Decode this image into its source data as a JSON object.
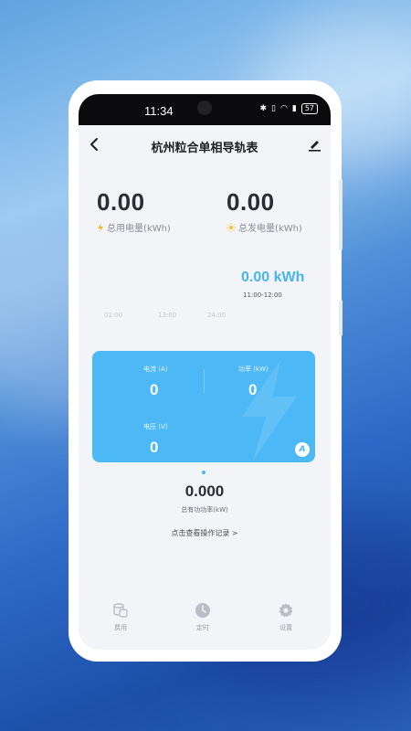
{
  "status_bar": {
    "time": "11:34",
    "battery": "57"
  },
  "header": {
    "title": "杭州粒合单相导轨表"
  },
  "stats": {
    "total_used_value": "0.00",
    "total_used_label": "总用电量(kWh)",
    "total_generated_value": "0.00",
    "total_generated_label": "总发电量(kWh)"
  },
  "chart": {
    "current_value": "0.00 kWh",
    "time_range": "11:00-12:00",
    "ticks": [
      "01:00",
      "13:00",
      "24:00"
    ]
  },
  "card": {
    "current_label": "电流 (A)",
    "current_value": "0",
    "power_label": "功率 (kW)",
    "power_value": "0",
    "voltage_label": "电压 (V)",
    "voltage_value": "0",
    "badge": "A"
  },
  "active_power": {
    "value": "0.000",
    "label": "总有功功率(kW)"
  },
  "record_link": "点击查看操作记录 >",
  "tabs": [
    {
      "label": "费用",
      "icon": "coins-icon"
    },
    {
      "label": "定时",
      "icon": "clock-icon"
    },
    {
      "label": "设置",
      "icon": "gear-icon"
    }
  ],
  "colors": {
    "accent": "#46b4f0",
    "card": "#4cb8f5",
    "bolt": "#f5b52a",
    "sun": "#f5c542"
  }
}
